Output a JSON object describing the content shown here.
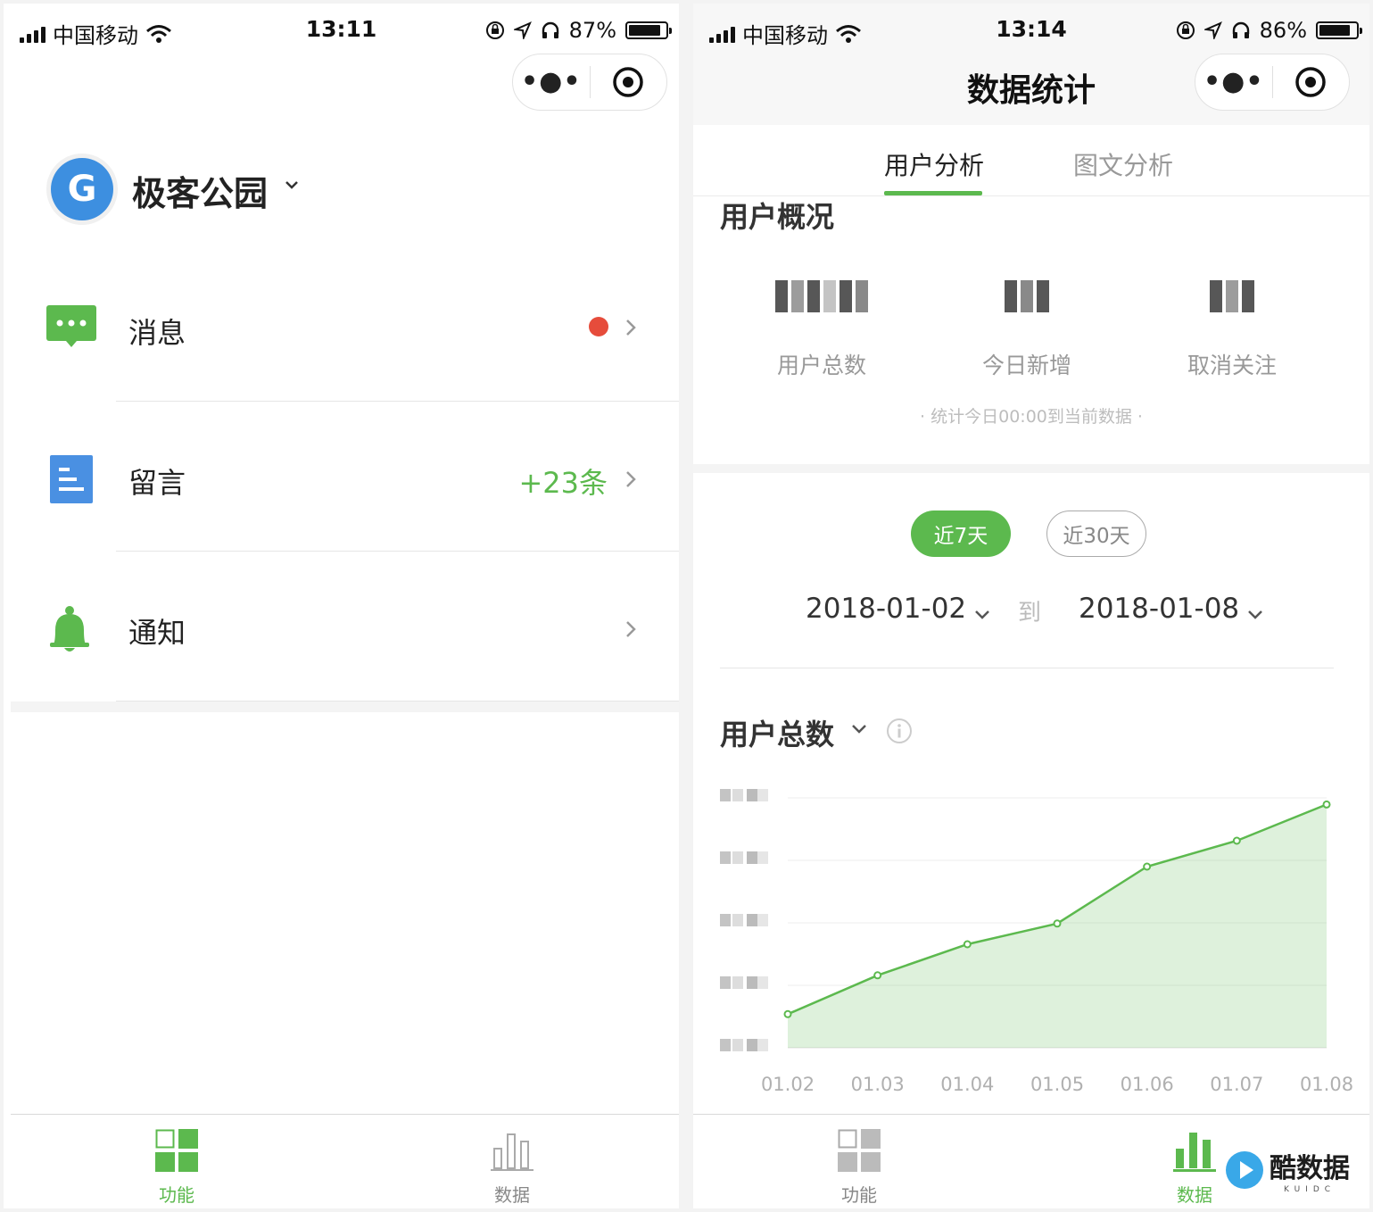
{
  "left_screen": {
    "status_bar": {
      "carrier": "中国移动",
      "time": "13:11",
      "battery": "87%",
      "battery_level": 0.87
    },
    "profile": {
      "avatar_letter": "G",
      "name": "极客公园"
    },
    "menu": [
      {
        "label": "消息",
        "icon": "message-icon",
        "badge": "red-dot"
      },
      {
        "label": "留言",
        "icon": "document-icon",
        "count": "+23条"
      },
      {
        "label": "通知",
        "icon": "bell-icon"
      }
    ],
    "tabbar": [
      {
        "label": "功能",
        "icon": "grid-icon",
        "active": true
      },
      {
        "label": "数据",
        "icon": "bar-chart-icon",
        "active": false
      }
    ]
  },
  "right_screen": {
    "status_bar": {
      "carrier": "中国移动",
      "time": "13:14",
      "battery": "86%",
      "battery_level": 0.86
    },
    "nav_title": "数据统计",
    "sub_tabs": [
      {
        "label": "用户分析",
        "active": true
      },
      {
        "label": "图文分析",
        "active": false
      }
    ],
    "overview": {
      "title": "用户概况",
      "stats": [
        {
          "label": "用户总数"
        },
        {
          "label": "今日新增"
        },
        {
          "label": "取消关注"
        }
      ],
      "note": "·  统计今日00:00到当前数据  ·"
    },
    "range_buttons": [
      {
        "label": "近7天",
        "active": true
      },
      {
        "label": "近30天",
        "active": false
      }
    ],
    "date_range": {
      "start": "2018-01-02",
      "separator": "到",
      "end": "2018-01-08"
    },
    "metric": {
      "title": "用户总数"
    },
    "tabbar": [
      {
        "label": "功能",
        "icon": "grid-icon",
        "active": false
      },
      {
        "label": "数据",
        "icon": "bar-chart-icon",
        "active": true
      }
    ],
    "watermark": {
      "text": "酷数据",
      "sub": "KUIDC"
    }
  },
  "colors": {
    "accent": "#5cb94e",
    "blue": "#4a90e2",
    "red_dot": "#e64c3b",
    "muted": "#999999"
  },
  "chart_data": {
    "type": "area",
    "categories": [
      "01.02",
      "01.03",
      "01.04",
      "01.05",
      "01.06",
      "01.07",
      "01.08"
    ],
    "series": [
      {
        "values": [
          0.13,
          0.28,
          0.4,
          0.48,
          0.7,
          0.8,
          0.94
        ]
      }
    ],
    "ylim": [
      0,
      1
    ],
    "y_tick_labels_obscured": true,
    "grid": true,
    "note": "y-axis values are pixelated in the screenshot; series values are relative heights"
  }
}
